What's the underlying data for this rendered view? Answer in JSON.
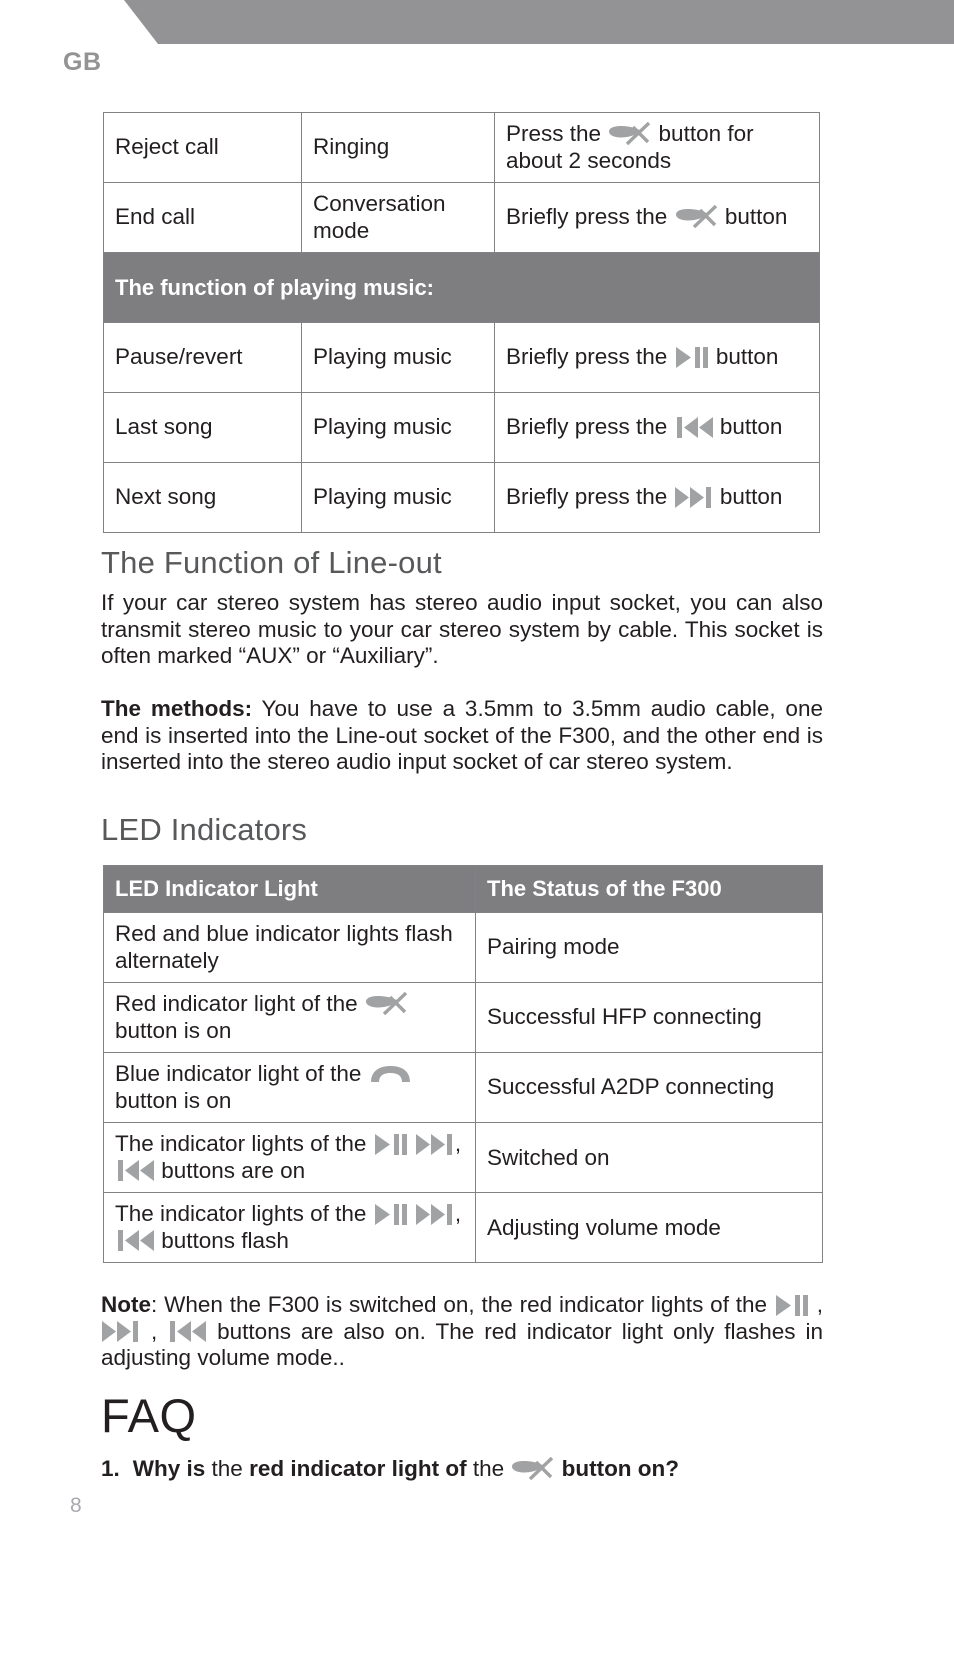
{
  "header": {
    "language_code": "GB"
  },
  "call_music_table": {
    "rows": [
      {
        "type": "data",
        "action": "Reject call",
        "state": "Ringing",
        "operation_before": "Press the ",
        "icon": "end-call-icon",
        "operation_after": " button for about 2 seconds"
      },
      {
        "type": "data",
        "action": "End call",
        "state": "Conversation mode",
        "operation_before": "Briefly press the ",
        "icon": "end-call-icon",
        "operation_after": " button"
      },
      {
        "type": "section",
        "label": "The function of playing music:"
      },
      {
        "type": "data",
        "action": "Pause/revert",
        "state": "Playing music",
        "operation_before": "Briefly press the ",
        "icon": "play-pause-icon",
        "operation_after": " button"
      },
      {
        "type": "data",
        "action": "Last song",
        "state": "Playing music",
        "operation_before": "Briefly press the ",
        "icon": "previous-track-icon",
        "operation_after": " button"
      },
      {
        "type": "data",
        "action": "Next song",
        "state": "Playing music",
        "operation_before": "Briefly press the ",
        "icon": "next-track-icon",
        "operation_after": " button"
      }
    ]
  },
  "line_out_section": {
    "heading": "The Function of Line-out",
    "paragraph": "If your car stereo system has stereo audio input socket, you can also transmit stereo music to your car stereo system by cable. This socket is often marked “AUX” or “Auxiliary”.",
    "methods_label": "The methods:",
    "methods_text": " You have to use a 3.5mm to 3.5mm audio cable, one end is inserted into the Line-out socket of the F300, and the other end is inserted into the stereo audio input socket of car stereo system."
  },
  "led_section": {
    "heading": "LED Indicators",
    "table": {
      "columns": [
        "LED Indicator Light",
        "The Status of the F300"
      ],
      "rows": [
        {
          "indicator_parts": [
            {
              "text": "Red and blue indicator lights flash alternately"
            }
          ],
          "status": "Pairing mode"
        },
        {
          "indicator_parts": [
            {
              "text": "Red indicator light of the "
            },
            {
              "icon": "end-call-icon"
            },
            {
              "text": " button is on"
            }
          ],
          "status": "Successful HFP connecting"
        },
        {
          "indicator_parts": [
            {
              "text": "Blue indicator light of the "
            },
            {
              "icon": "answer-call-icon"
            },
            {
              "text": " button is on"
            }
          ],
          "status": "Successful A2DP connecting"
        },
        {
          "indicator_parts": [
            {
              "text": "The indicator lights of the "
            },
            {
              "icon": "play-pause-icon"
            },
            {
              "text": " "
            },
            {
              "icon": "next-track-icon"
            },
            {
              "text": ", "
            },
            {
              "icon": "previous-track-icon"
            },
            {
              "text": " buttons are on"
            }
          ],
          "status": "Switched on"
        },
        {
          "indicator_parts": [
            {
              "text": "The indicator lights of the "
            },
            {
              "icon": "play-pause-icon"
            },
            {
              "text": " "
            },
            {
              "icon": "next-track-icon"
            },
            {
              "text": ", "
            },
            {
              "icon": "previous-track-icon"
            },
            {
              "text": " buttons flash"
            }
          ],
          "status": "Adjusting volume mode"
        }
      ]
    }
  },
  "note": {
    "label": "Note",
    "parts": [
      {
        "text": ": When the F300 is switched on, the red indicator lights of the "
      },
      {
        "icon": "play-pause-icon"
      },
      {
        "text": " , "
      },
      {
        "icon": "next-track-icon"
      },
      {
        "text": " , "
      },
      {
        "icon": "previous-track-icon"
      },
      {
        "text": " buttons are also on. The red indicator light only flashes in adjusting volume mode.."
      }
    ]
  },
  "faq": {
    "heading": "FAQ",
    "items": [
      {
        "number": "1.",
        "parts": [
          {
            "text": "Why is ",
            "bold": true
          },
          {
            "text": "the ",
            "bold": false
          },
          {
            "text": "red indicator light of ",
            "bold": true
          },
          {
            "text": "the ",
            "bold": false
          },
          {
            "icon": "end-call-icon"
          },
          {
            "text": " button on?",
            "bold": true
          }
        ]
      }
    ]
  },
  "footer": {
    "page_number": "8"
  },
  "colors": {
    "banner_gray": "#939395",
    "table_header_gray": "#7e7e80",
    "border_gray": "#818285",
    "heading_gray": "#58595b",
    "icon_gray": "#a0a2a4",
    "page_number_gray": "#a7a9ac",
    "text_black": "#231f20"
  }
}
